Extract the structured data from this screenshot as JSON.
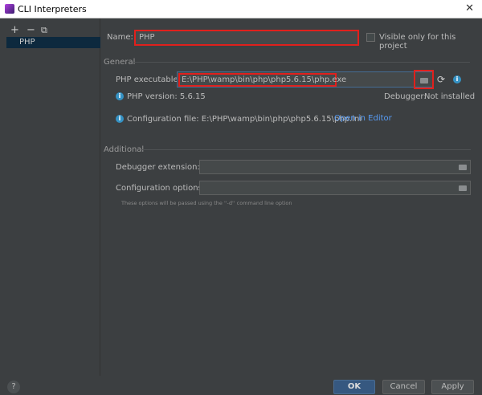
{
  "window": {
    "title": "CLI Interpreters",
    "close": "✕"
  },
  "sidebar": {
    "add": "+",
    "remove": "−",
    "copy": "⧉",
    "items": [
      {
        "label": "PHP"
      }
    ]
  },
  "name": {
    "label": "Name:",
    "value": "PHP",
    "visible_only_label": "Visible only for this project"
  },
  "general": {
    "title": "General",
    "exe_label": "PHP executable:",
    "exe_value": "E:\\PHP\\wamp\\bin\\php\\php5.6.15\\php.exe",
    "version": "PHP version: 5.6.15",
    "debugger_label": "Debugger:",
    "debugger_value": "Not installed",
    "config": "Configuration file: E:\\PHP\\wamp\\bin\\php\\php5.6.15\\php.ini",
    "open_editor": "Open in Editor"
  },
  "additional": {
    "title": "Additional",
    "debugger_ext_label": "Debugger extension:",
    "config_opts_label": "Configuration options:",
    "hint": "These options will be passed using the ''-d'' command line option"
  },
  "footer": {
    "help": "?",
    "ok": "OK",
    "cancel": "Cancel",
    "apply": "Apply"
  },
  "colors": {
    "accent": "#365880",
    "highlight": "#e0201c",
    "link": "#589df6"
  }
}
